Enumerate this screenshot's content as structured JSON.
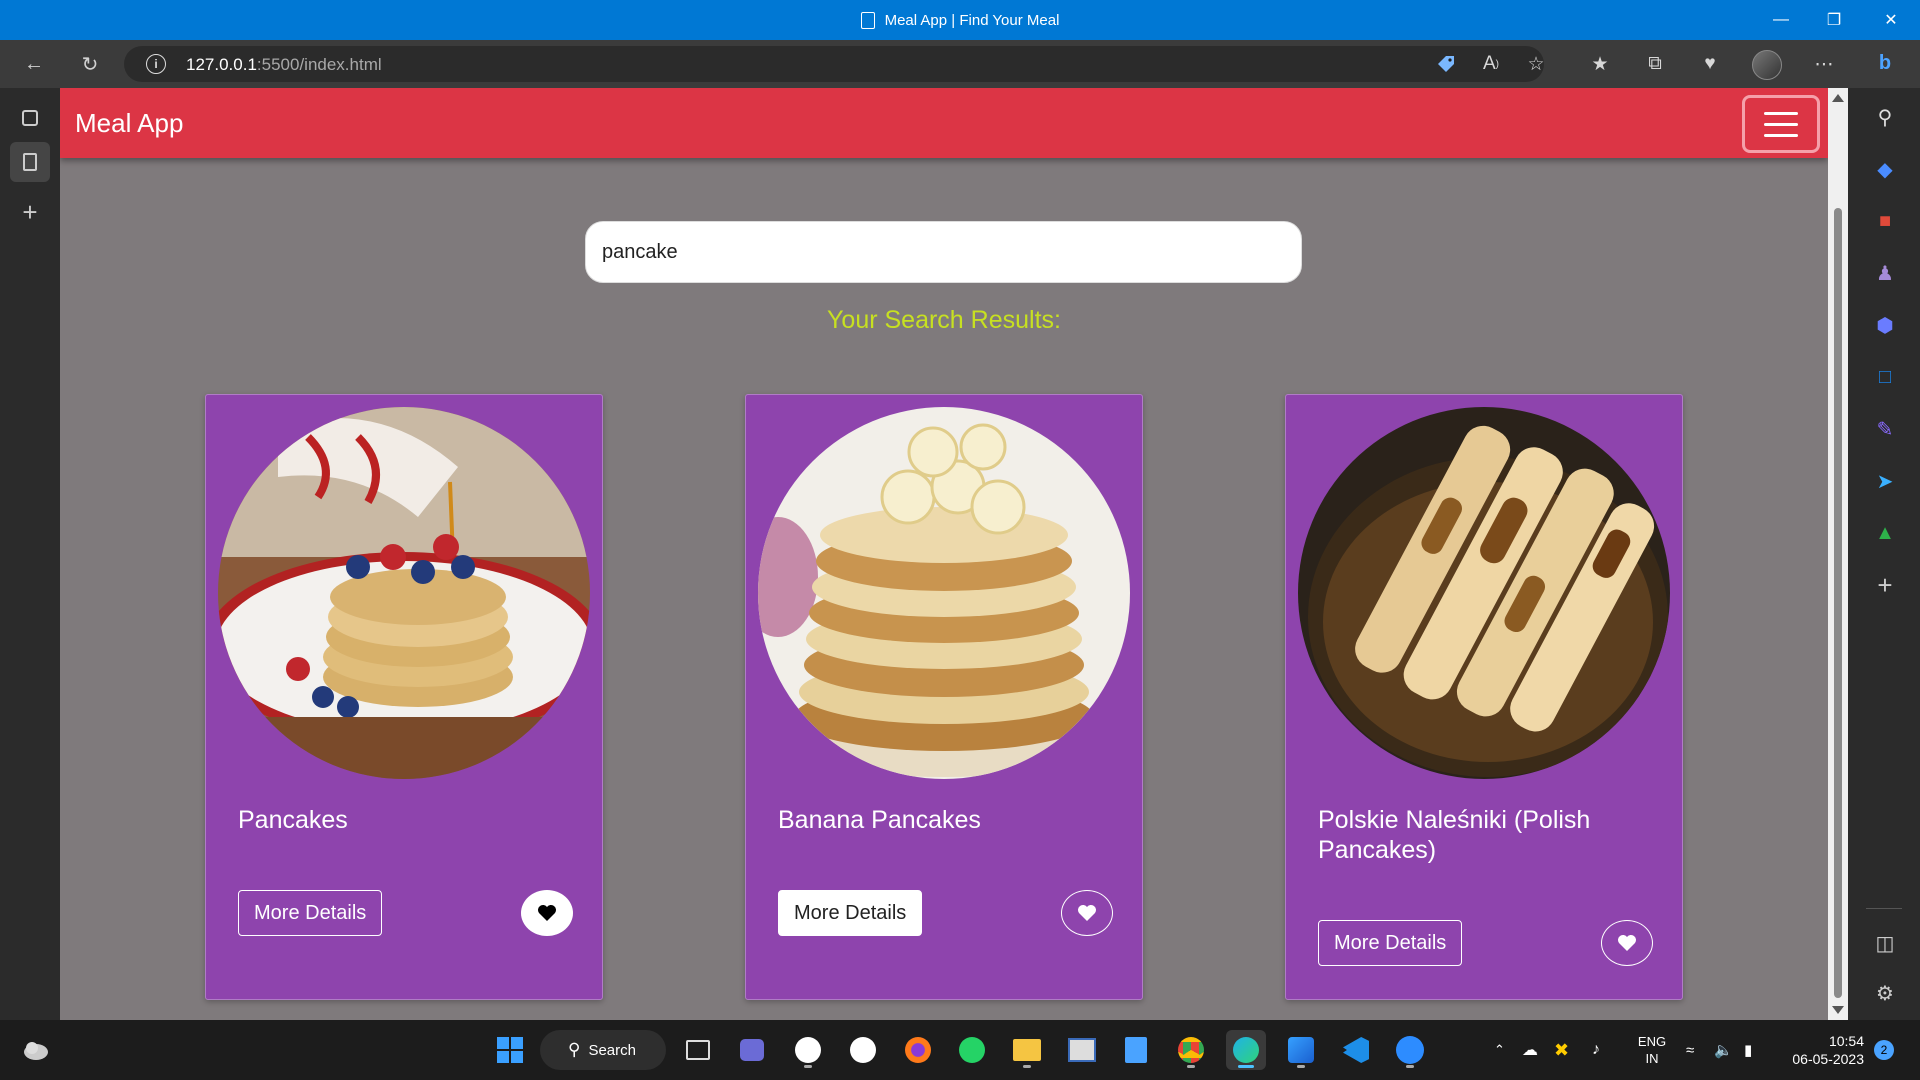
{
  "window": {
    "title": "Meal App | Find Your Meal"
  },
  "browser": {
    "url_host": "127.0.0.1",
    "url_path": ":5500/index.html"
  },
  "app": {
    "brand": "Meal App",
    "search": {
      "value": "pancake",
      "placeholder": ""
    },
    "results_heading": "Your Search Results:",
    "meals": [
      {
        "name": "Pancakes",
        "button": "More Details",
        "favorited": true
      },
      {
        "name": "Banana Pancakes",
        "button": "More Details",
        "favorited": false
      },
      {
        "name": "Polskie Naleśniki (Polish Pancakes)",
        "button": "More Details",
        "favorited": false
      }
    ]
  },
  "taskbar": {
    "search_label": "Search",
    "lang_line1": "ENG",
    "lang_line2": "IN",
    "time": "10:54",
    "date": "06-05-2023",
    "notifications": "2"
  },
  "colors": {
    "navbar": "#dc3545",
    "card": "#8e44ad",
    "heading": "#c7e021",
    "page_bg": "#7f7a7c"
  }
}
